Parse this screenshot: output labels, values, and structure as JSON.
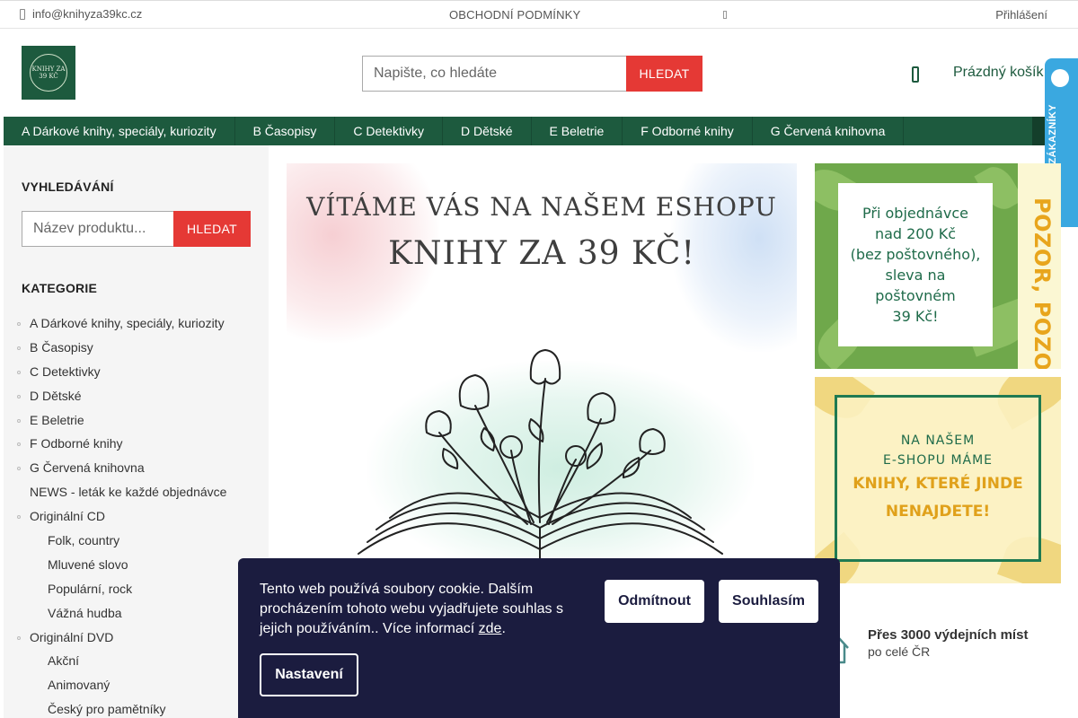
{
  "topbar": {
    "email": "info@knihyza39kc.cz",
    "terms": "OBCHODNÍ PODMÍNKY",
    "login": "Přihlášení"
  },
  "header": {
    "logo_text": "KNIHY ZA 39 KČ",
    "search_placeholder": "Napište, co hledáte",
    "search_button": "HLEDAT",
    "cart": "Prázdný košík",
    "verified_badge": "OVĚŘENO ZÁKAZNÍKY"
  },
  "nav": {
    "items": [
      "A Dárkové knihy, speciály, kuriozity",
      "B Časopisy",
      "C Detektivky",
      "D Dětské",
      "E Beletrie",
      "F Odborné knihy",
      "G Červená knihovna"
    ]
  },
  "sidebar": {
    "search_heading": "VYHLEDÁVÁNÍ",
    "search_placeholder": "Název produktu...",
    "search_button": "HLEDAT",
    "categories_heading": "KATEGORIE",
    "categories": [
      {
        "label": "A Dárkové knihy, speciály, kuriozity",
        "level": 0,
        "bullet": true
      },
      {
        "label": "B Časopisy",
        "level": 0,
        "bullet": true
      },
      {
        "label": "C Detektivky",
        "level": 0,
        "bullet": true
      },
      {
        "label": "D Dětské",
        "level": 0,
        "bullet": true
      },
      {
        "label": "E Beletrie",
        "level": 0,
        "bullet": true
      },
      {
        "label": "F Odborné knihy",
        "level": 0,
        "bullet": true
      },
      {
        "label": "G Červená knihovna",
        "level": 0,
        "bullet": true
      },
      {
        "label": "NEWS - leták ke každé objednávce",
        "level": 0,
        "bullet": false
      },
      {
        "label": "Originální CD",
        "level": 0,
        "bullet": true
      },
      {
        "label": "Folk, country",
        "level": 1,
        "bullet": false
      },
      {
        "label": "Mluvené slovo",
        "level": 1,
        "bullet": false
      },
      {
        "label": "Populární, rock",
        "level": 1,
        "bullet": false
      },
      {
        "label": "Vážná hudba",
        "level": 1,
        "bullet": false
      },
      {
        "label": "Originální DVD",
        "level": 0,
        "bullet": true
      },
      {
        "label": "Akční",
        "level": 1,
        "bullet": false
      },
      {
        "label": "Animovaný",
        "level": 1,
        "bullet": false
      },
      {
        "label": "Český pro pamětníky",
        "level": 1,
        "bullet": false
      }
    ]
  },
  "hero": {
    "line1": "VÍTÁME VÁS NA NAŠEM ESHOPU",
    "line2": "KNIHY ZA 39 KČ!"
  },
  "banner1": {
    "card_lines": [
      "Při objednávce",
      "nad 200 Kč",
      "(bez poštovného),",
      "sleva na",
      "poštovném",
      "39 Kč!"
    ],
    "vertical": "POZOR, POZOR!"
  },
  "banner2": {
    "line1": "NA NAŠEM",
    "line2": "E-SHOPU MÁME",
    "line3": "KNIHY, KTERÉ JINDE",
    "line4": "NENAJDETE!"
  },
  "pickup": {
    "title": "Přes 3000 výdejních míst",
    "subtitle": "po celé ČR"
  },
  "cookie": {
    "text": "Tento web používá soubory cookie. Dalším procházením tohoto webu vyjadřujete souhlas s jejich používáním.. Více informací ",
    "link": "zde",
    "text_end": ".",
    "decline": "Odmítnout",
    "accept": "Souhlasím",
    "settings": "Nastavení"
  },
  "colors": {
    "brand_green": "#1d5a3e",
    "accent_red": "#e53935",
    "cookie_bg": "#1b1c3f",
    "verified_blue": "#3aa8e0"
  }
}
